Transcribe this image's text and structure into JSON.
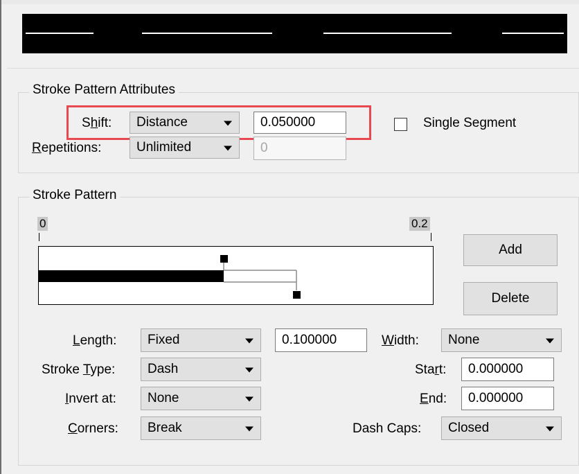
{
  "preview": {
    "segments": 4
  },
  "stroke_pattern_attributes": {
    "title": "Stroke Pattern Attributes",
    "shift_label": "Shift:",
    "shift_mode": "Distance",
    "shift_value": "0.050000",
    "single_segment_label": "Single Segment",
    "single_segment_checked": false,
    "repetitions_label": "Repetitions:",
    "repetitions_mode": "Unlimited",
    "repetitions_value": "0"
  },
  "stroke_pattern": {
    "title": "Stroke Pattern",
    "ruler_start": "0",
    "ruler_end": "0.2",
    "add_label": "Add",
    "delete_label": "Delete",
    "length_label": "Length:",
    "length_mode": "Fixed",
    "length_value": "0.100000",
    "width_label": "Width:",
    "width_mode": "None",
    "stroke_type_label": "Stroke Type:",
    "stroke_type": "Dash",
    "start_label": "Start:",
    "start_value": "0.000000",
    "invert_label": "Invert at:",
    "invert_value": "None",
    "end_label": "End:",
    "end_value": "0.000000",
    "corners_label": "Corners:",
    "corners_value": "Break",
    "dash_caps_label": "Dash Caps:",
    "dash_caps_value": "Closed"
  }
}
